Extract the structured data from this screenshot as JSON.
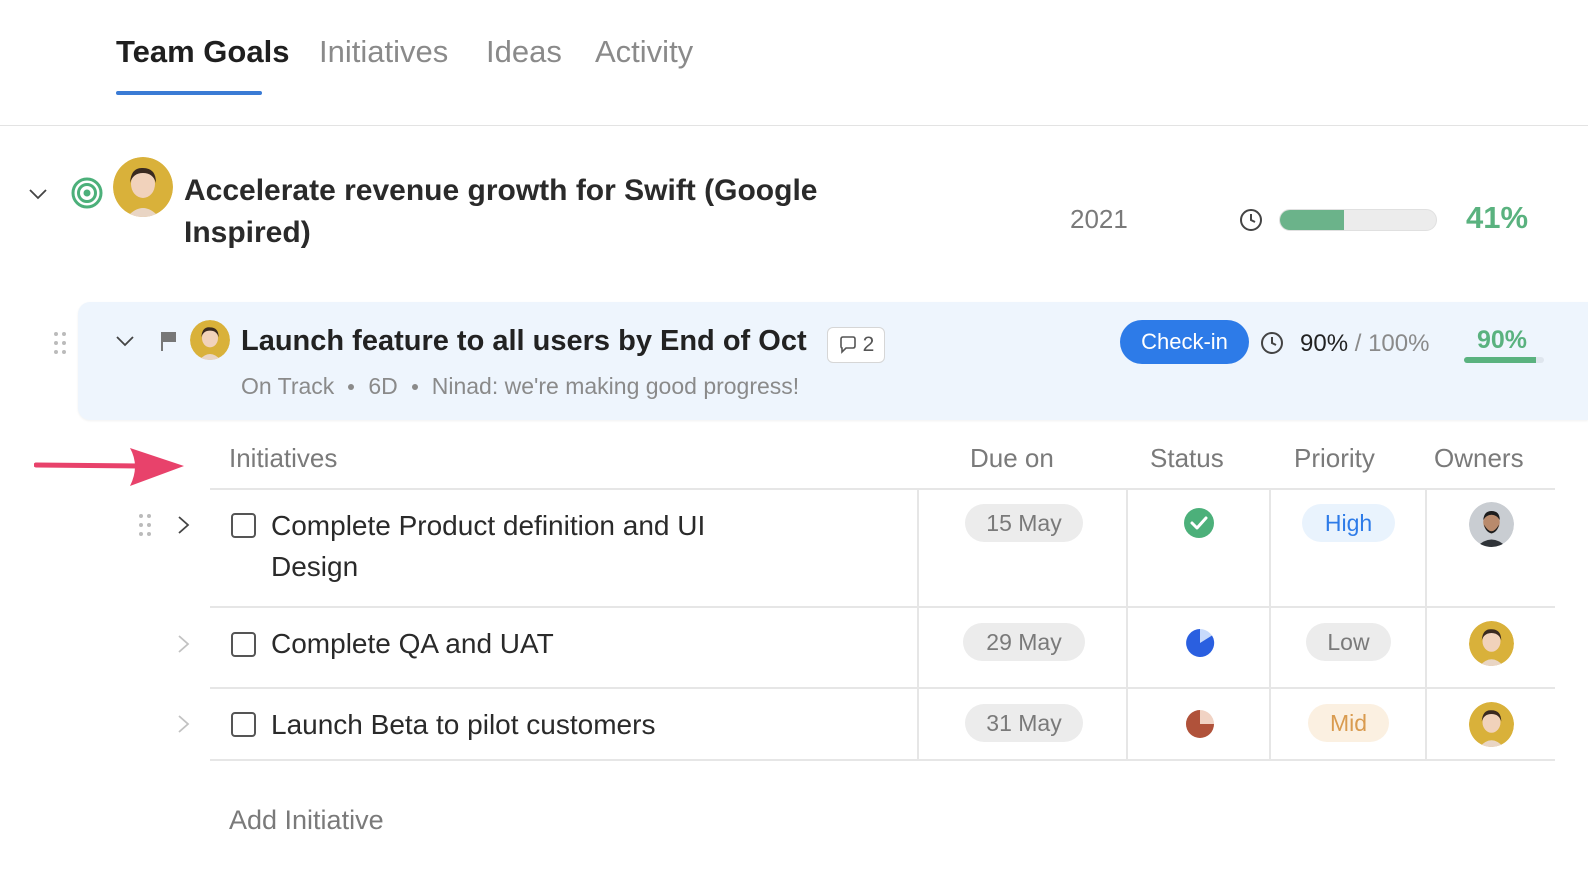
{
  "tabs": [
    {
      "label": "Team Goals",
      "active": true
    },
    {
      "label": "Initiatives",
      "active": false
    },
    {
      "label": "Ideas",
      "active": false
    },
    {
      "label": "Activity",
      "active": false
    }
  ],
  "goal": {
    "title": "Accelerate revenue growth for Swift (Google Inspired)",
    "year": "2021",
    "progress_percent": 41,
    "progress_label": "41%"
  },
  "key_result": {
    "title": "Launch feature to all users by End of Oct",
    "comment_count": "2",
    "status": "On Track",
    "time_left": "6D",
    "latest_update": "Ninad: we're making good progress!",
    "checkin_label": "Check-in",
    "current_value": "90%",
    "separator": " / ",
    "target_value": "100%",
    "progress_percent": 90,
    "progress_label": "90%"
  },
  "table": {
    "headers": {
      "initiatives": "Initiatives",
      "due_on": "Due on",
      "status": "Status",
      "priority": "Priority",
      "owners": "Owners"
    },
    "rows": [
      {
        "title_line1": "Complete Product definition and UI",
        "title_line2": "Design",
        "due": "15 May",
        "status": "done",
        "priority": "High"
      },
      {
        "title_line1": "Complete QA and UAT",
        "due": "29 May",
        "status": "partial-blue",
        "priority": "Low"
      },
      {
        "title_line1": "Launch Beta to pilot customers",
        "due": "31 May",
        "status": "partial-brown",
        "priority": "Mid"
      }
    ],
    "add_label": "Add Initiative"
  },
  "colors": {
    "accent_blue": "#2d7be8",
    "success_green": "#5ab27f",
    "priority_high_bg": "#e9f3fd",
    "priority_high_fg": "#2d7be8",
    "priority_low_bg": "#ececec",
    "priority_low_fg": "#7a7a7a",
    "priority_mid_bg": "#fbf0e1",
    "priority_mid_fg": "#d99b4f",
    "arrow_pink": "#e8426b"
  }
}
